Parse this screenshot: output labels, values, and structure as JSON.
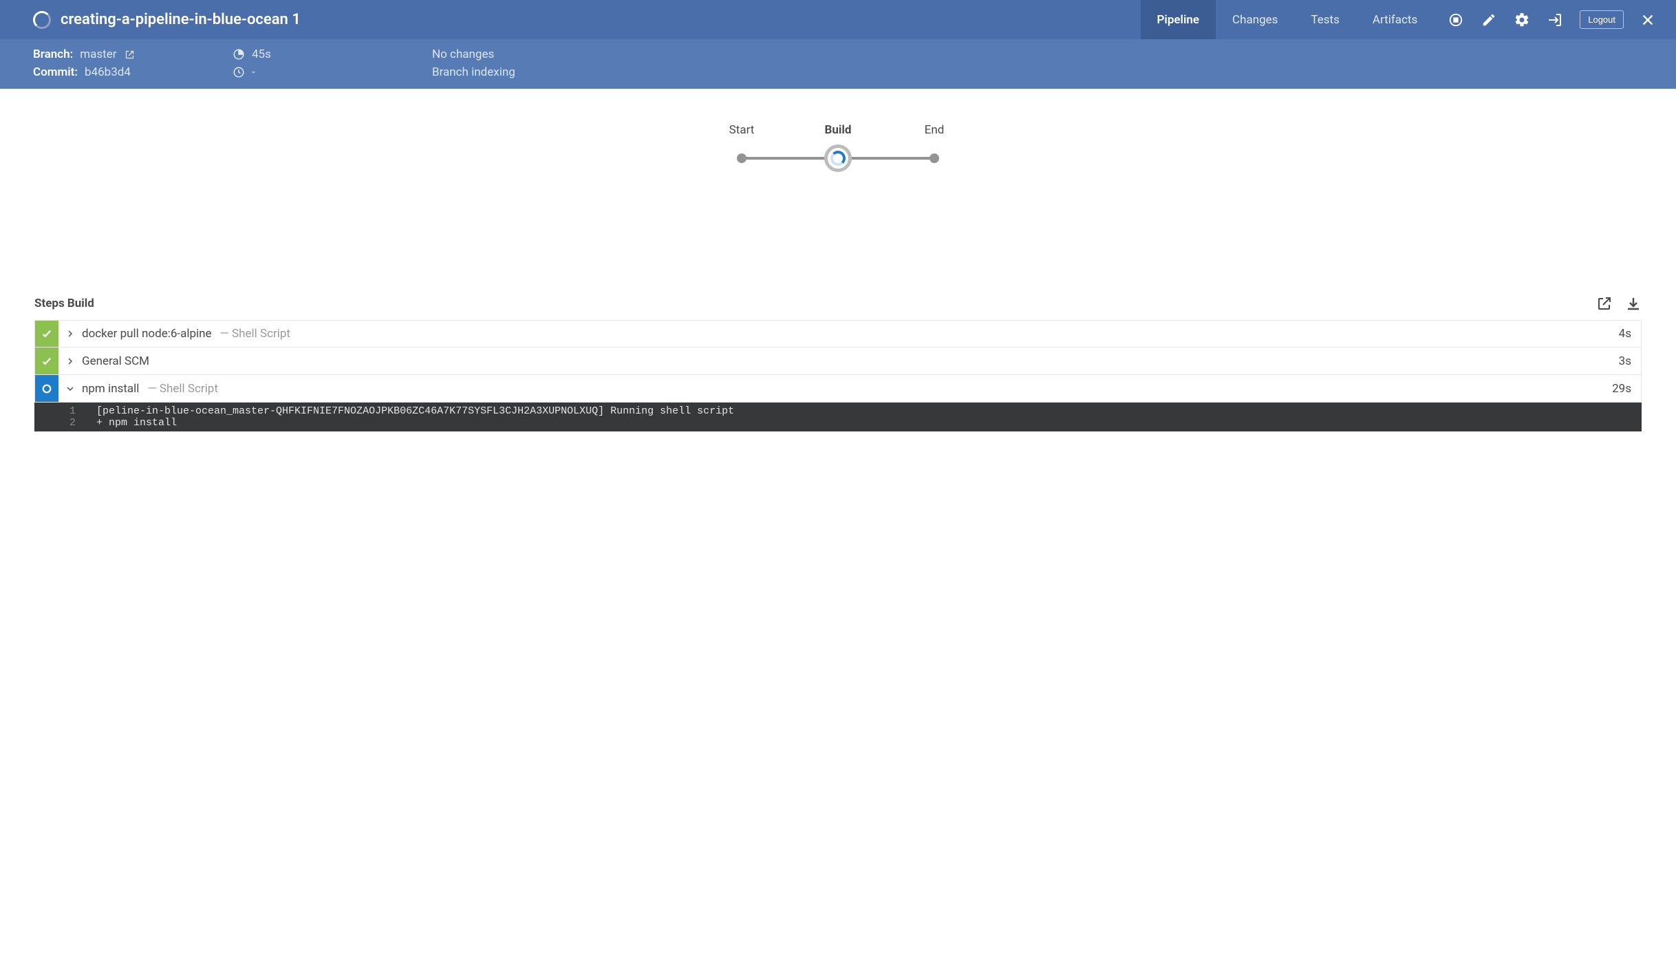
{
  "colors": {
    "headerTop": "#4a6ea9",
    "headerSub": "#577bb5",
    "success": "#8cc04f",
    "running": "#1d7dca"
  },
  "header": {
    "title": "creating-a-pipeline-in-blue-ocean 1",
    "tabs": [
      {
        "label": "Pipeline",
        "active": true
      },
      {
        "label": "Changes",
        "active": false
      },
      {
        "label": "Tests",
        "active": false
      },
      {
        "label": "Artifacts",
        "active": false
      }
    ],
    "logout": "Logout"
  },
  "subheader": {
    "branch_label": "Branch:",
    "branch_value": "master",
    "commit_label": "Commit:",
    "commit_value": "b46b3d4",
    "duration": "45s",
    "queue_time": "-",
    "changes_line1": "No changes",
    "changes_line2": "Branch indexing"
  },
  "pipeline": {
    "stages": [
      {
        "name": "Start",
        "status": "done"
      },
      {
        "name": "Build",
        "status": "running"
      },
      {
        "name": "End",
        "status": "pending"
      }
    ]
  },
  "steps": {
    "heading": "Steps Build",
    "items": [
      {
        "status": "success",
        "expanded": false,
        "name": "docker pull node:6-alpine",
        "subtitle": "— Shell Script",
        "duration": "4s"
      },
      {
        "status": "success",
        "expanded": false,
        "name": "General SCM",
        "subtitle": "",
        "duration": "3s"
      },
      {
        "status": "running",
        "expanded": true,
        "name": "npm install",
        "subtitle": "— Shell Script",
        "duration": "29s",
        "log": [
          "[peline-in-blue-ocean_master-QHFKIFNIE7FNOZAOJPKB06ZC46A7K77SYSFL3CJH2A3XUPNOLXUQ] Running shell script",
          "+ npm install"
        ]
      }
    ]
  }
}
